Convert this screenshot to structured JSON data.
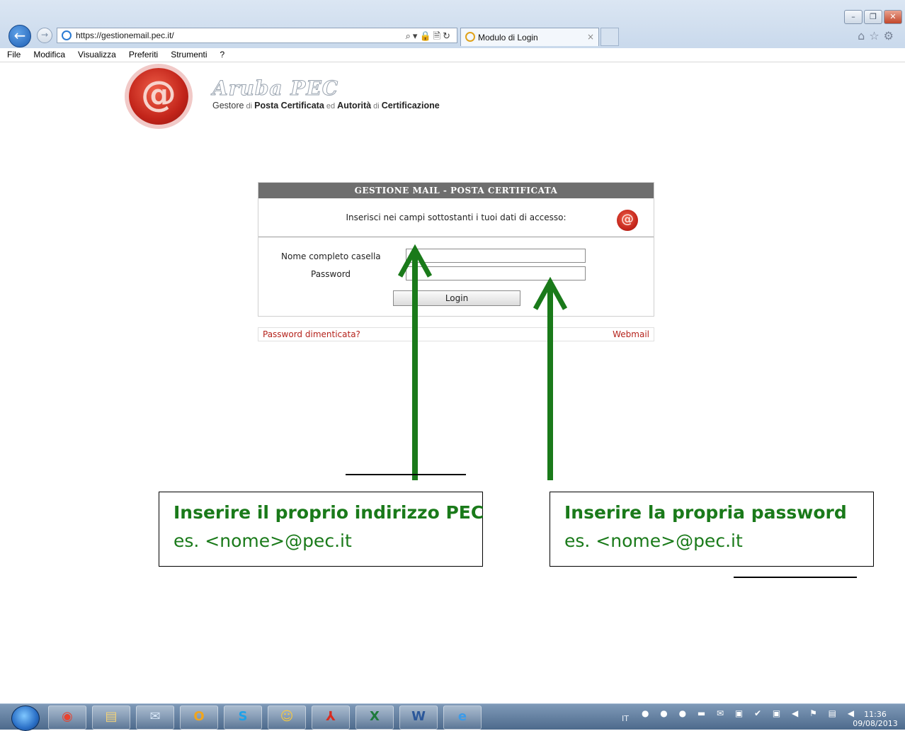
{
  "browser": {
    "url": "https://gestionemail.pec.it/",
    "tab_title": "Modulo di Login",
    "menu": [
      "File",
      "Modifica",
      "Visualizza",
      "Preferiti",
      "Strumenti",
      "?"
    ]
  },
  "logo": {
    "brand": "Aruba PEC",
    "tagline_parts": [
      "Gestore",
      " di ",
      "Posta Certificata",
      " ed ",
      "Autorità",
      " di ",
      "Certificazione"
    ]
  },
  "login": {
    "header": "GESTIONE MAIL - POSTA CERTIFICATA",
    "intro": "Inserisci nei campi sottostanti i tuoi dati di accesso:",
    "label_mailbox": "Nome completo casella",
    "label_password": "Password",
    "mailbox_value": "",
    "password_value": "",
    "login_button": "Login",
    "forgot_link": "Password dimenticata?",
    "webmail_link": "Webmail"
  },
  "annotations": {
    "left": {
      "title": "Inserire il proprio indirizzo PEC",
      "body": "es. <nome>@pec.it"
    },
    "right": {
      "title": "Inserire la propria password",
      "body": "es. <nome>@pec.it"
    },
    "arrow_color": "#1a7a1a"
  },
  "taskbar": {
    "language": "IT",
    "time": "11:36",
    "date": "09/08/2013",
    "apps": [
      "chrome",
      "explorer",
      "outlook",
      "outlook-express",
      "skype",
      "contacts",
      "acrobat",
      "excel",
      "word",
      "internet-explorer"
    ]
  }
}
